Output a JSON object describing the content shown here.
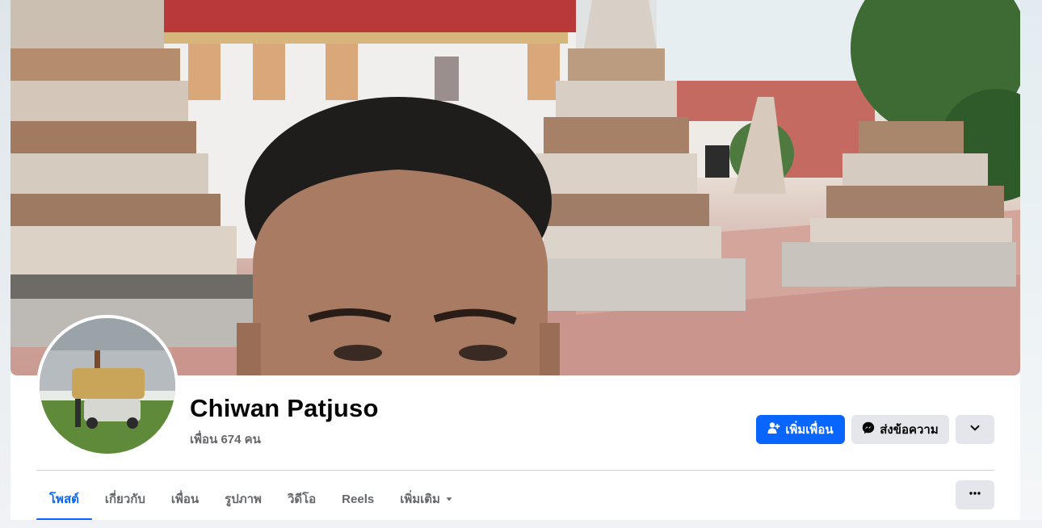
{
  "profile": {
    "name": "Chiwan Patjuso",
    "friends_text": "เพื่อน 674 คน"
  },
  "actions": {
    "add_friend_label": "เพิ่มเพื่อน",
    "message_label": "ส่งข้อความ"
  },
  "tabs": [
    {
      "label": "โพสต์",
      "active": true
    },
    {
      "label": "เกี่ยวกับ",
      "active": false
    },
    {
      "label": "เพื่อน",
      "active": false
    },
    {
      "label": "รูปภาพ",
      "active": false
    },
    {
      "label": "วิดีโอ",
      "active": false
    },
    {
      "label": "Reels",
      "active": false
    },
    {
      "label": "เพิ่มเติม",
      "active": false
    }
  ],
  "colors": {
    "accent": "#0866ff",
    "secondary_button": "#e4e6eb",
    "muted_text": "#65676b"
  },
  "icons": {
    "add_friend": "person-plus-icon",
    "message": "messenger-icon",
    "more_dropdown": "chevron-down-icon",
    "tab_more": "caret-down-icon",
    "options": "ellipsis-icon"
  }
}
